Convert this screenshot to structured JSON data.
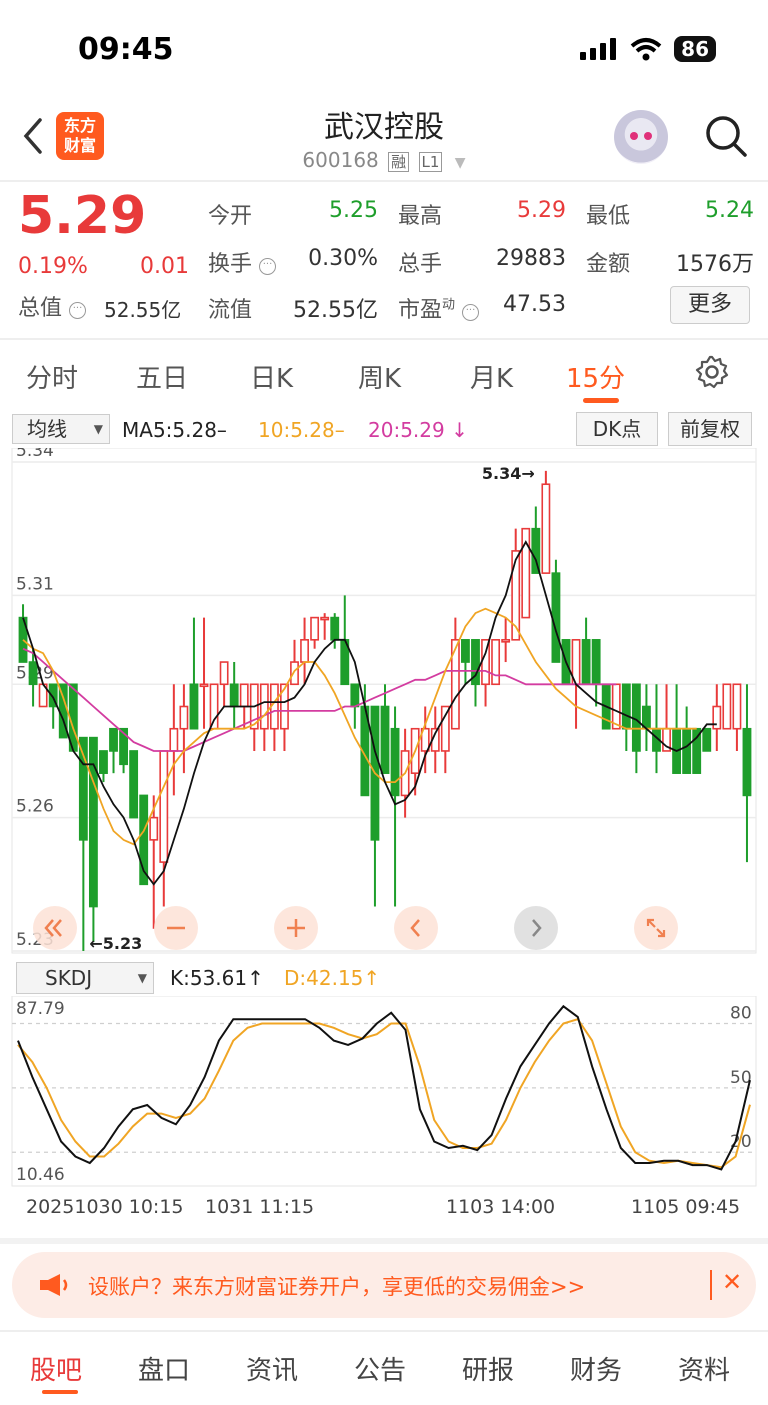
{
  "status_bar": {
    "time": "09:45",
    "battery": "86"
  },
  "header": {
    "stock_name": "武汉控股",
    "stock_code": "600168",
    "tag_margin": "融",
    "tag_level": "L1",
    "logo_text_1": "东方",
    "logo_text_2": "财富"
  },
  "quote": {
    "price": "5.29",
    "change_pct": "0.19%",
    "change": "0.01",
    "total_value_label": "总值",
    "total_value": "52.55亿",
    "open_label": "今开",
    "open": "5.25",
    "high_label": "最高",
    "high": "5.29",
    "low_label": "最低",
    "low": "5.24",
    "turnover_label": "换手",
    "turnover": "0.30%",
    "volume_label": "总手",
    "volume": "29883",
    "amount_label": "金额",
    "amount": "1576万",
    "float_value_label": "流值",
    "float_value": "52.55亿",
    "pe_label": "市盈",
    "pe_super": "动",
    "pe": "47.53",
    "more_label": "更多"
  },
  "tabs": [
    "分时",
    "五日",
    "日K",
    "周K",
    "月K",
    "15分"
  ],
  "active_tab": "15分",
  "ma_bar": {
    "selector": "均线",
    "ma5": "MA5:5.28–",
    "ma10": "10:5.28–",
    "ma20": "20:5.29",
    "ma20_arrow": "↓",
    "dk_label": "DK点",
    "fq_label": "前复权"
  },
  "colors": {
    "up": "#e83a3a",
    "down": "#1e9e2b",
    "ma5": "#111111",
    "ma10": "#f0a524",
    "ma20": "#d33ca0",
    "accent": "#ff5a1f"
  },
  "chart_data": [
    {
      "type": "candlestick",
      "price_axis_labels": [
        "5.34",
        "5.31",
        "5.29",
        "5.26",
        "5.23"
      ],
      "max_label": "5.34",
      "min_label": "5.23",
      "candles": [
        {
          "o": 5.305,
          "c": 5.295,
          "h": 5.308,
          "l": 5.295
        },
        {
          "o": 5.295,
          "c": 5.29,
          "h": 5.298,
          "l": 5.285
        },
        {
          "o": 5.285,
          "c": 5.29,
          "h": 5.29,
          "l": 5.285
        },
        {
          "o": 5.29,
          "c": 5.285,
          "h": 5.29,
          "l": 5.28
        },
        {
          "o": 5.29,
          "c": 5.278,
          "h": 5.29,
          "l": 5.278
        },
        {
          "o": 5.29,
          "c": 5.275,
          "h": 5.29,
          "l": 5.275
        },
        {
          "o": 5.278,
          "c": 5.255,
          "h": 5.278,
          "l": 5.23
        },
        {
          "o": 5.278,
          "c": 5.24,
          "h": 5.278,
          "l": 5.232
        },
        {
          "o": 5.275,
          "c": 5.27,
          "h": 5.275,
          "l": 5.268
        },
        {
          "o": 5.28,
          "c": 5.275,
          "h": 5.28,
          "l": 5.27
        },
        {
          "o": 5.28,
          "c": 5.272,
          "h": 5.28,
          "l": 5.27
        },
        {
          "o": 5.275,
          "c": 5.26,
          "h": 5.275,
          "l": 5.26
        },
        {
          "o": 5.265,
          "c": 5.245,
          "h": 5.265,
          "l": 5.245
        },
        {
          "o": 5.255,
          "c": 5.26,
          "h": 5.265,
          "l": 5.235
        },
        {
          "o": 5.25,
          "c": 5.275,
          "h": 5.275,
          "l": 5.24
        },
        {
          "o": 5.275,
          "c": 5.28,
          "h": 5.29,
          "l": 5.265
        },
        {
          "o": 5.28,
          "c": 5.285,
          "h": 5.29,
          "l": 5.27
        },
        {
          "o": 5.29,
          "c": 5.28,
          "h": 5.305,
          "l": 5.28
        },
        {
          "o": 5.29,
          "c": 5.29,
          "h": 5.305,
          "l": 5.28
        },
        {
          "o": 5.28,
          "c": 5.29,
          "h": 5.29,
          "l": 5.28
        },
        {
          "o": 5.29,
          "c": 5.295,
          "h": 5.295,
          "l": 5.285
        },
        {
          "o": 5.29,
          "c": 5.285,
          "h": 5.295,
          "l": 5.28
        },
        {
          "o": 5.285,
          "c": 5.29,
          "h": 5.29,
          "l": 5.28
        },
        {
          "o": 5.28,
          "c": 5.29,
          "h": 5.29,
          "l": 5.275
        },
        {
          "o": 5.28,
          "c": 5.29,
          "h": 5.29,
          "l": 5.275
        },
        {
          "o": 5.28,
          "c": 5.29,
          "h": 5.29,
          "l": 5.275
        },
        {
          "o": 5.28,
          "c": 5.29,
          "h": 5.29,
          "l": 5.275
        },
        {
          "o": 5.29,
          "c": 5.295,
          "h": 5.3,
          "l": 5.29
        },
        {
          "o": 5.295,
          "c": 5.3,
          "h": 5.305,
          "l": 5.29
        },
        {
          "o": 5.3,
          "c": 5.305,
          "h": 5.305,
          "l": 5.298
        },
        {
          "o": 5.305,
          "c": 5.305,
          "h": 5.306,
          "l": 5.3
        },
        {
          "o": 5.305,
          "c": 5.3,
          "h": 5.306,
          "l": 5.298
        },
        {
          "o": 5.3,
          "c": 5.29,
          "h": 5.31,
          "l": 5.29
        },
        {
          "o": 5.29,
          "c": 5.285,
          "h": 5.29,
          "l": 5.28
        },
        {
          "o": 5.285,
          "c": 5.265,
          "h": 5.29,
          "l": 5.265
        },
        {
          "o": 5.285,
          "c": 5.255,
          "h": 5.285,
          "l": 5.24
        },
        {
          "o": 5.285,
          "c": 5.27,
          "h": 5.29,
          "l": 5.27
        },
        {
          "o": 5.28,
          "c": 5.265,
          "h": 5.285,
          "l": 5.24
        },
        {
          "o": 5.265,
          "c": 5.275,
          "h": 5.28,
          "l": 5.26
        },
        {
          "o": 5.27,
          "c": 5.28,
          "h": 5.28,
          "l": 5.265
        },
        {
          "o": 5.275,
          "c": 5.28,
          "h": 5.285,
          "l": 5.27
        },
        {
          "o": 5.275,
          "c": 5.28,
          "h": 5.285,
          "l": 5.27
        },
        {
          "o": 5.275,
          "c": 5.285,
          "h": 5.285,
          "l": 5.27
        },
        {
          "o": 5.28,
          "c": 5.3,
          "h": 5.305,
          "l": 5.28
        },
        {
          "o": 5.3,
          "c": 5.295,
          "h": 5.3,
          "l": 5.29
        },
        {
          "o": 5.3,
          "c": 5.29,
          "h": 5.3,
          "l": 5.285
        },
        {
          "o": 5.29,
          "c": 5.3,
          "h": 5.3,
          "l": 5.285
        },
        {
          "o": 5.29,
          "c": 5.3,
          "h": 5.3,
          "l": 5.29
        },
        {
          "o": 5.3,
          "c": 5.3,
          "h": 5.305,
          "l": 5.295
        },
        {
          "o": 5.3,
          "c": 5.32,
          "h": 5.325,
          "l": 5.3
        },
        {
          "o": 5.305,
          "c": 5.325,
          "h": 5.325,
          "l": 5.305
        },
        {
          "o": 5.325,
          "c": 5.315,
          "h": 5.33,
          "l": 5.315
        },
        {
          "o": 5.315,
          "c": 5.335,
          "h": 5.338,
          "l": 5.315
        },
        {
          "o": 5.315,
          "c": 5.295,
          "h": 5.318,
          "l": 5.295
        },
        {
          "o": 5.3,
          "c": 5.29,
          "h": 5.3,
          "l": 5.29
        },
        {
          "o": 5.29,
          "c": 5.3,
          "h": 5.3,
          "l": 5.28
        },
        {
          "o": 5.3,
          "c": 5.29,
          "h": 5.305,
          "l": 5.29
        },
        {
          "o": 5.3,
          "c": 5.29,
          "h": 5.3,
          "l": 5.285
        },
        {
          "o": 5.29,
          "c": 5.28,
          "h": 5.29,
          "l": 5.28
        },
        {
          "o": 5.28,
          "c": 5.29,
          "h": 5.29,
          "l": 5.28
        },
        {
          "o": 5.29,
          "c": 5.28,
          "h": 5.29,
          "l": 5.275
        },
        {
          "o": 5.29,
          "c": 5.275,
          "h": 5.29,
          "l": 5.27
        },
        {
          "o": 5.285,
          "c": 5.28,
          "h": 5.29,
          "l": 5.275
        },
        {
          "o": 5.28,
          "c": 5.275,
          "h": 5.29,
          "l": 5.27
        },
        {
          "o": 5.275,
          "c": 5.28,
          "h": 5.29,
          "l": 5.275
        },
        {
          "o": 5.28,
          "c": 5.27,
          "h": 5.29,
          "l": 5.27
        },
        {
          "o": 5.28,
          "c": 5.27,
          "h": 5.285,
          "l": 5.27
        },
        {
          "o": 5.28,
          "c": 5.27,
          "h": 5.28,
          "l": 5.27
        },
        {
          "o": 5.28,
          "c": 5.275,
          "h": 5.28,
          "l": 5.275
        },
        {
          "o": 5.28,
          "c": 5.285,
          "h": 5.29,
          "l": 5.275
        },
        {
          "o": 5.28,
          "c": 5.29,
          "h": 5.29,
          "l": 5.28
        },
        {
          "o": 5.28,
          "c": 5.29,
          "h": 5.29,
          "l": 5.275
        },
        {
          "o": 5.28,
          "c": 5.265,
          "h": 5.29,
          "l": 5.25
        }
      ],
      "ma5": [
        5.305,
        5.298,
        5.29,
        5.287,
        5.282,
        5.275,
        5.272,
        5.272,
        5.267,
        5.263,
        5.26,
        5.255,
        5.248,
        5.245,
        5.248,
        5.255,
        5.262,
        5.27,
        5.277,
        5.282,
        5.285,
        5.285,
        5.285,
        5.285,
        5.286,
        5.286,
        5.286,
        5.287,
        5.29,
        5.295,
        5.298,
        5.3,
        5.3,
        5.295,
        5.285,
        5.275,
        5.268,
        5.263,
        5.264,
        5.267,
        5.274,
        5.279,
        5.283,
        5.287,
        5.29,
        5.292,
        5.297,
        5.305,
        5.31,
        5.318,
        5.322,
        5.318,
        5.31,
        5.302,
        5.295,
        5.29,
        5.288,
        5.286,
        5.285,
        5.284,
        5.283,
        5.282,
        5.28,
        5.278,
        5.276,
        5.275,
        5.276,
        5.278,
        5.281,
        5.281
      ],
      "ma10": [
        5.3,
        5.298,
        5.297,
        5.293,
        5.287,
        5.28,
        5.274,
        5.268,
        5.262,
        5.257,
        5.255,
        5.254,
        5.257,
        5.262,
        5.267,
        5.272,
        5.275,
        5.277,
        5.279,
        5.28,
        5.28,
        5.28,
        5.28,
        5.281,
        5.283,
        5.286,
        5.289,
        5.293,
        5.295,
        5.295,
        5.292,
        5.288,
        5.283,
        5.278,
        5.274,
        5.27,
        5.268,
        5.268,
        5.27,
        5.275,
        5.281,
        5.287,
        5.293,
        5.298,
        5.303,
        5.306,
        5.307,
        5.306,
        5.305,
        5.303,
        5.299,
        5.295,
        5.292,
        5.289,
        5.287,
        5.285,
        5.284,
        5.283,
        5.282,
        5.281,
        5.28,
        5.28,
        5.28,
        5.28,
        5.28,
        5.28,
        5.28,
        5.28
      ],
      "ma20": [
        5.298,
        5.297,
        5.295,
        5.293,
        5.291,
        5.289,
        5.287,
        5.285,
        5.283,
        5.281,
        5.279,
        5.277,
        5.276,
        5.275,
        5.275,
        5.275,
        5.275,
        5.276,
        5.277,
        5.278,
        5.279,
        5.28,
        5.281,
        5.282,
        5.283,
        5.284,
        5.284,
        5.284,
        5.284,
        5.284,
        5.284,
        5.284,
        5.285,
        5.285,
        5.286,
        5.287,
        5.288,
        5.289,
        5.29,
        5.291,
        5.291,
        5.292,
        5.293,
        5.293,
        5.293,
        5.293,
        5.293,
        5.292,
        5.292,
        5.291,
        5.29,
        5.29,
        5.29,
        5.29,
        5.29,
        5.29,
        5.29,
        5.29,
        5.29,
        5.29
      ]
    },
    {
      "type": "line",
      "indicator": "SKDJ",
      "k_label": "K:53.61",
      "k_arrow": "↑",
      "d_label": "D:42.15",
      "d_arrow": "↑",
      "max_label": "87.79",
      "min_label": "10.46",
      "ref_labels": [
        "80",
        "50",
        "20"
      ],
      "series": [
        {
          "name": "K",
          "values": [
            72,
            55,
            40,
            25,
            18,
            15,
            22,
            32,
            40,
            42,
            36,
            33,
            42,
            55,
            72,
            82,
            82,
            82,
            82,
            82,
            82,
            78,
            72,
            70,
            73,
            80,
            85,
            77,
            40,
            25,
            22,
            23,
            21,
            28,
            45,
            60,
            70,
            80,
            88,
            83,
            60,
            40,
            22,
            15,
            15,
            16,
            16,
            14,
            14,
            12,
            25,
            53.61
          ]
        },
        {
          "name": "D",
          "values": [
            70,
            62,
            50,
            35,
            25,
            18,
            18,
            24,
            32,
            38,
            38,
            36,
            38,
            45,
            58,
            72,
            78,
            80,
            80,
            80,
            80,
            80,
            78,
            75,
            73,
            75,
            80,
            80,
            60,
            35,
            25,
            22,
            22,
            24,
            35,
            50,
            62,
            72,
            80,
            82,
            72,
            52,
            32,
            20,
            16,
            15,
            16,
            15,
            14,
            13,
            18,
            42.15
          ]
        }
      ]
    }
  ],
  "chart_controls": [
    "fast-back",
    "zoom-out",
    "zoom-in",
    "prev",
    "next",
    "fullscreen"
  ],
  "x_dates": [
    "20251030 10:15",
    "1031 11:15",
    "1103 14:00",
    "1105 09:45"
  ],
  "banner": {
    "text": "设账户？来东方财富证券开户，享更低的交易佣金>>",
    "close": "✕"
  },
  "bottom_tabs": [
    "股吧",
    "盘口",
    "资讯",
    "公告",
    "研报",
    "财务",
    "资料"
  ],
  "active_bottom_tab": "股吧"
}
